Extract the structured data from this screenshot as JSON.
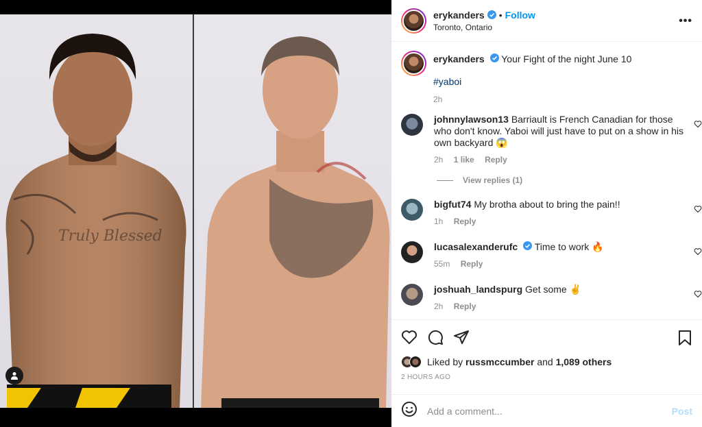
{
  "post": {
    "username": "erykanders",
    "follow_label": "Follow",
    "separator": "•",
    "location": "Toronto, Ontario",
    "more_label": "•••"
  },
  "caption": {
    "username": "erykanders",
    "text": "Your Fight of the night June 10",
    "hashtag": "#yaboi",
    "time": "2h"
  },
  "comments": [
    {
      "username": "johnnylawson13",
      "text": "Barriault is French Canadian for those who don't know. Yaboi will just have to put on a show in his own backyard 😱",
      "time": "2h",
      "likes": "1 like",
      "reply": "Reply",
      "view_replies": "View replies (1)"
    },
    {
      "username": "bigfut74",
      "text": "My brotha about to bring the pain!!",
      "time": "1h",
      "reply": "Reply"
    },
    {
      "username": "lucasalexanderufc",
      "text": "Time to work 🔥",
      "time": "55m",
      "reply": "Reply"
    },
    {
      "username": "joshuah_landspurg",
      "text": "Get some ✌",
      "time": "2h",
      "reply": "Reply"
    }
  ],
  "likes": {
    "prefix": "Liked by",
    "user": "russmccumber",
    "and": "and",
    "others": "1,089 others"
  },
  "time_ago": "2 HOURS AGO",
  "add_comment": {
    "placeholder": "Add a comment...",
    "post_label": "Post"
  },
  "colors": {
    "accent": "#0095f6",
    "verified": "#3897f0",
    "muted": "#8e8e8e"
  }
}
